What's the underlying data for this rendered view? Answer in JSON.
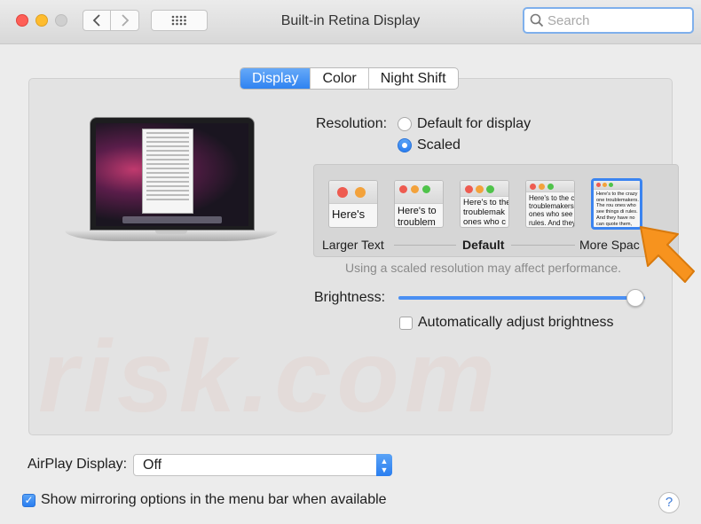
{
  "window": {
    "title": "Built-in Retina Display"
  },
  "search": {
    "placeholder": "Search"
  },
  "tabs": [
    {
      "label": "Display",
      "active": true
    },
    {
      "label": "Color",
      "active": false
    },
    {
      "label": "Night Shift",
      "active": false
    }
  ],
  "resolution": {
    "label": "Resolution:",
    "options": [
      {
        "label": "Default for display",
        "selected": false
      },
      {
        "label": "Scaled",
        "selected": true
      }
    ]
  },
  "scaling": {
    "thumbnails": [
      {
        "text": "Here's",
        "selected": false
      },
      {
        "text": "Here's to troublem",
        "selected": false
      },
      {
        "text": "Here's to the troublemak ones who c",
        "selected": false
      },
      {
        "text": "Here's to the c troublemakers. ones who see t rules. And they",
        "selected": false
      },
      {
        "text": "Here's to the crazy one troublemakers. The rou ones who see things di rules. And they have no can quote them, disagr them. About the only th Because they change",
        "selected": true
      }
    ],
    "labels": {
      "left": "Larger Text",
      "middle": "Default",
      "right": "More Spac"
    },
    "note": "Using a scaled resolution may affect performance."
  },
  "brightness": {
    "label": "Brightness:",
    "level": 0.96
  },
  "auto_brightness": {
    "label": "Automatically adjust brightness",
    "checked": false
  },
  "airplay": {
    "label": "AirPlay Display:",
    "value": "Off"
  },
  "mirroring": {
    "label": "Show mirroring options in the menu bar when available",
    "checked": true
  },
  "help": {
    "label": "?"
  },
  "colors": {
    "accent": "#2f83f1",
    "arrow": "#f7931e"
  }
}
